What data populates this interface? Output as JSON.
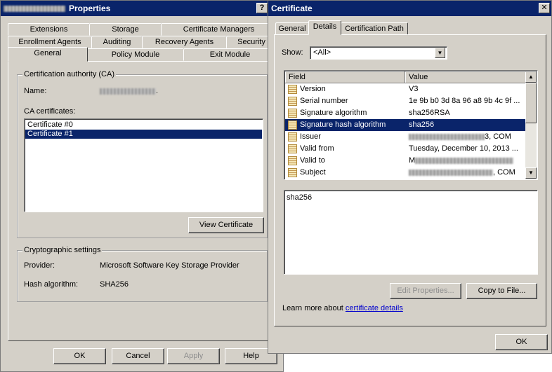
{
  "properties": {
    "title": "Properties",
    "help_glyph": "?",
    "tabs_row1": [
      "Extensions",
      "Storage",
      "Certificate Managers"
    ],
    "tabs_row2": [
      "Enrollment Agents",
      "Auditing",
      "Recovery Agents",
      "Security"
    ],
    "tabs_row3": [
      "General",
      "Policy Module",
      "Exit Module"
    ],
    "ca_group_title": "Certification authority (CA)",
    "name_label": "Name:",
    "name_suffix": ".",
    "ca_certs_label": "CA certificates:",
    "certificates": [
      "Certificate #0",
      "Certificate #1"
    ],
    "view_cert_button": "View Certificate",
    "crypto_group_title": "Cryptographic settings",
    "provider_label": "Provider:",
    "provider_value": "Microsoft Software Key Storage Provider",
    "hash_label": "Hash algorithm:",
    "hash_value": "SHA256",
    "buttons": {
      "ok": "OK",
      "cancel": "Cancel",
      "apply": "Apply",
      "help": "Help"
    }
  },
  "certificate": {
    "title": "Certificate",
    "close_glyph": "✕",
    "tabs": [
      "General",
      "Details",
      "Certification Path"
    ],
    "show_label": "Show:",
    "show_value": "<All>",
    "columns": {
      "field": "Field",
      "value": "Value"
    },
    "rows": [
      {
        "field": "Version",
        "value": "V3"
      },
      {
        "field": "Serial number",
        "value": "1e 9b b0 3d 8a 96 a8 9b 4c 9f ..."
      },
      {
        "field": "Signature algorithm",
        "value": "sha256RSA"
      },
      {
        "field": "Signature hash algorithm",
        "value": "sha256"
      },
      {
        "field": "Issuer",
        "value": "3, COM"
      },
      {
        "field": "Valid from",
        "value": "Tuesday, December 10, 2013 ..."
      },
      {
        "field": "Valid to",
        "value": "M"
      },
      {
        "field": "Subject",
        "value": ", COM"
      }
    ],
    "selected_row": 3,
    "detail_text": "sha256",
    "edit_properties_button": "Edit Properties...",
    "copy_to_file_button": "Copy to File...",
    "learn_more_prefix": "Learn more about ",
    "learn_more_link": "certificate details",
    "ok_button": "OK"
  }
}
